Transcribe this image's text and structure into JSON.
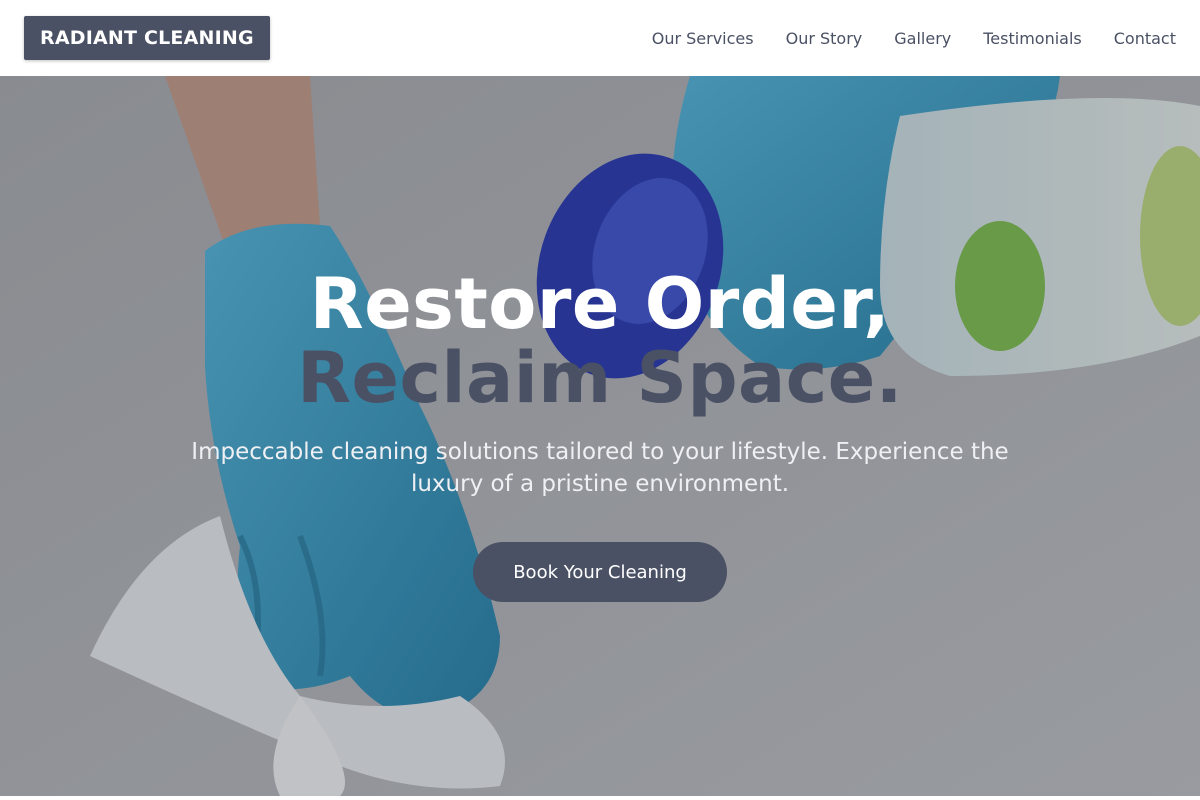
{
  "brand": {
    "logo_text": "RADIANT CLEANING"
  },
  "nav": {
    "items": [
      {
        "label": "Our Services"
      },
      {
        "label": "Our Story"
      },
      {
        "label": "Gallery"
      },
      {
        "label": "Testimonials"
      },
      {
        "label": "Contact"
      }
    ]
  },
  "hero": {
    "headline_line1": "Restore Order,",
    "headline_line2": "Reclaim Space.",
    "subtext": "Impeccable cleaning solutions tailored to your lifestyle. Experience the luxury of a pristine environment.",
    "cta_label": "Book Your Cleaning"
  },
  "colors": {
    "accent": "#4a5164",
    "glove": "#3aa3c9",
    "spray_cap": "#2233b0",
    "background": "#ffffff"
  }
}
